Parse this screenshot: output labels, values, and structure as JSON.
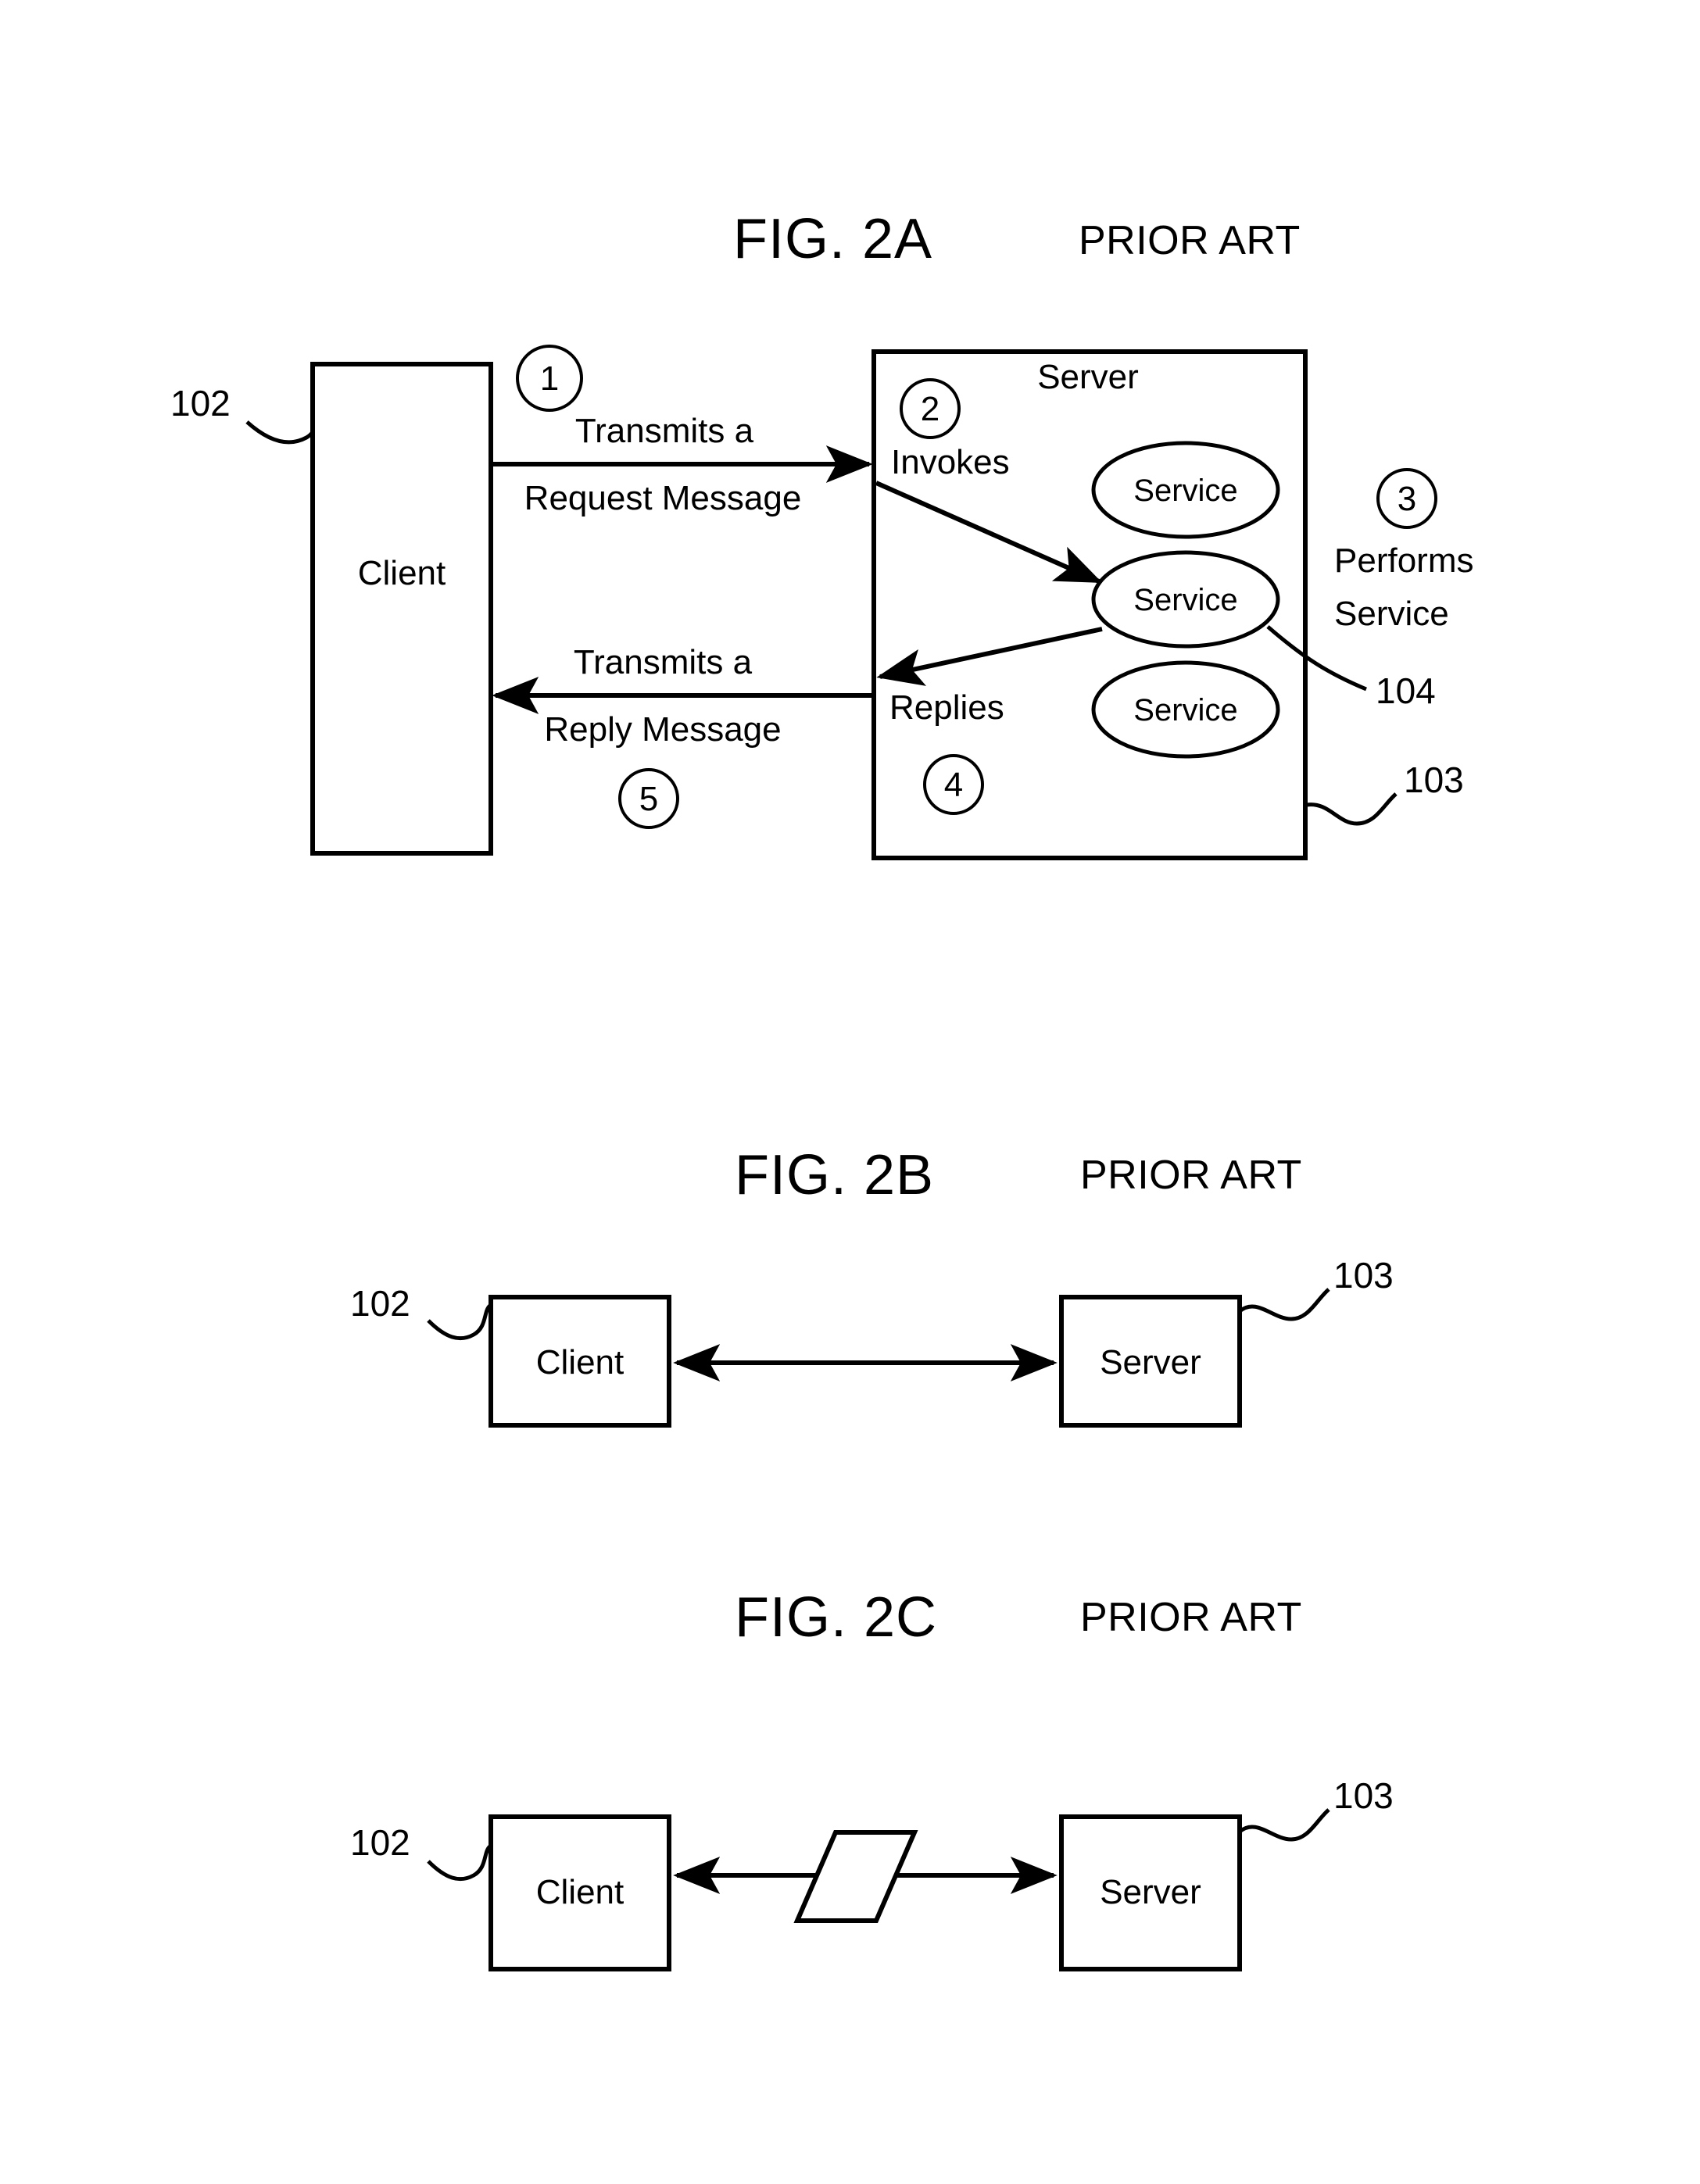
{
  "document": {
    "type": "patent-figure-sheet",
    "background_color": "#ffffff",
    "ink_color": "#000000"
  },
  "figures": [
    {
      "id": "fig-2a",
      "title": "FIG. 2A",
      "prior_art": "PRIOR ART",
      "client": {
        "label": "Client",
        "ref": "102"
      },
      "server": {
        "label": "Server",
        "ref": "103",
        "services": [
          {
            "label": "Service"
          },
          {
            "label": "Service"
          },
          {
            "label": "Service"
          }
        ],
        "service_ref": "104"
      },
      "steps": [
        {
          "number": "1",
          "label_line1": "Transmits a",
          "label_line2": "Request Message"
        },
        {
          "number": "2",
          "label_line1": "Invokes",
          "label_line2": ""
        },
        {
          "number": "3",
          "label_line1": "Performs",
          "label_line2": "Service"
        },
        {
          "number": "4",
          "label_line1": "Replies",
          "label_line2": ""
        },
        {
          "number": "5",
          "label_line1": "Transmits a",
          "label_line2": "Reply Message"
        }
      ]
    },
    {
      "id": "fig-2b",
      "title": "FIG. 2B",
      "prior_art": "PRIOR ART",
      "client": {
        "label": "Client",
        "ref": "102"
      },
      "server": {
        "label": "Server",
        "ref": "103"
      },
      "link": {
        "type": "bidirectional-arrow"
      }
    },
    {
      "id": "fig-2c",
      "title": "FIG. 2C",
      "prior_art": "PRIOR ART",
      "client": {
        "label": "Client",
        "ref": "102"
      },
      "server": {
        "label": "Server",
        "ref": "103"
      },
      "link": {
        "type": "bidirectional-arrow",
        "interposed_shape": "parallelogram"
      }
    }
  ]
}
